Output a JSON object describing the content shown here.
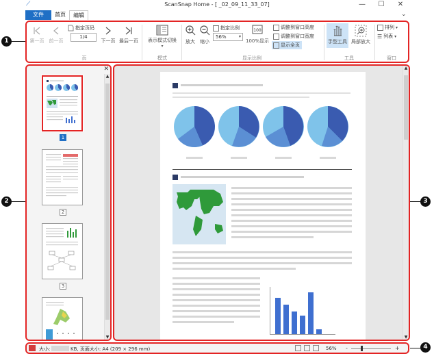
{
  "window": {
    "title": "ScanSnap Home - [      _02_09_11_33_07]",
    "minimize": "—",
    "maximize": "☐",
    "close": "✕",
    "collapse": "⌄"
  },
  "tabs": [
    {
      "label": "文件"
    },
    {
      "label": "首页"
    },
    {
      "label": "编辑"
    }
  ],
  "ribbon": {
    "page_group": {
      "label": "页",
      "first": "第一页",
      "prev": "前一页",
      "specify": "指定页码",
      "page_value": "1/4",
      "next": "下一页",
      "last": "最后一页"
    },
    "mode_group": {
      "label": "模式",
      "switch": "表示模式切换"
    },
    "zoom_group": {
      "label": "显示比例",
      "zoom_in": "放大",
      "zoom_out": "缩小",
      "specify_ratio": "指定比例",
      "ratio_value": "56%",
      "hundred": "100%显示",
      "fit_height": "调整到窗口高度",
      "fit_width": "调整到窗口宽度",
      "whole_page": "显示全页"
    },
    "tools_group": {
      "label": "工具",
      "hand": "手型工具",
      "local_zoom": "局部放大"
    },
    "window_group": {
      "label": "窗口",
      "arrange": "排列",
      "list": "列表"
    }
  },
  "thumbnails": [
    {
      "num": "1"
    },
    {
      "num": "2"
    },
    {
      "num": "3"
    }
  ],
  "status": {
    "size_label": "大小:",
    "size_value": "KB, 页面大小: A4 (209 × 296 mm)",
    "zoom": "56%"
  },
  "callouts": [
    "1",
    "2",
    "3",
    "4"
  ],
  "colors": {
    "accent": "#1f6fc5",
    "highlight": "#e32424",
    "pie_dark": "#3a5bb0",
    "pie_light": "#7fc3ea",
    "map_green": "#2f9a3a",
    "bar_blue": "#3f6fd0"
  }
}
